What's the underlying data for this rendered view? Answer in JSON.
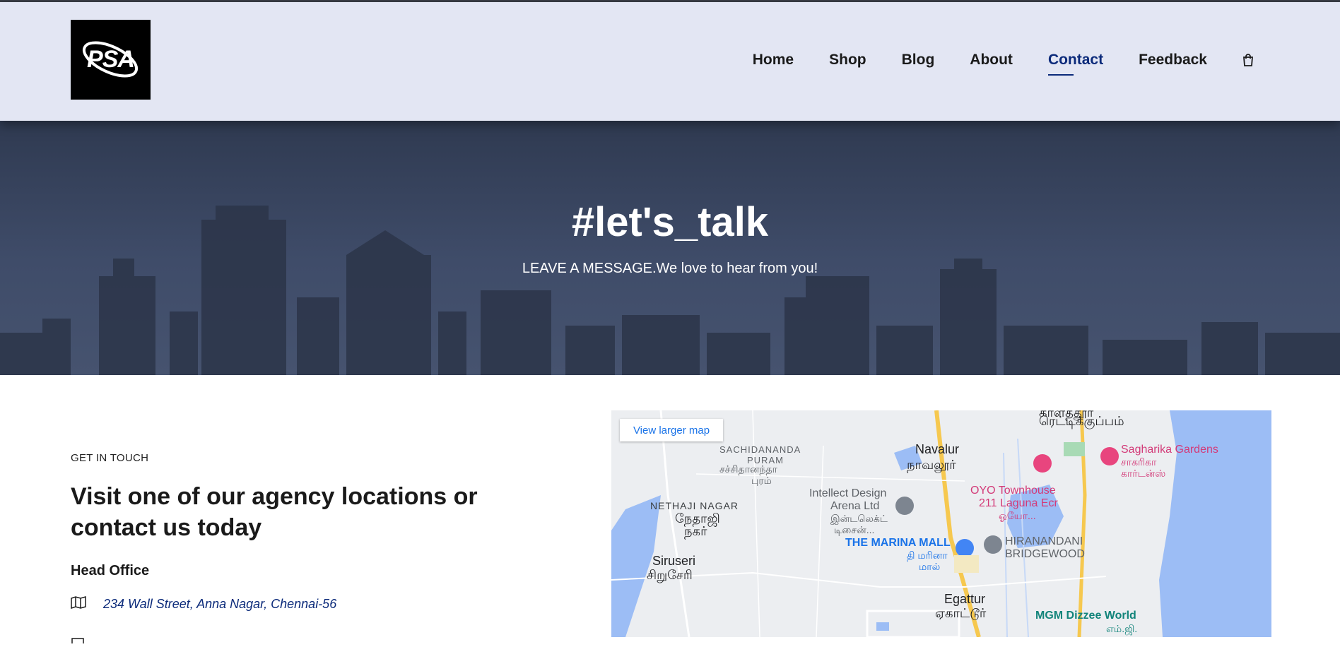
{
  "logo": {
    "text": "PSA"
  },
  "nav": {
    "items": [
      "Home",
      "Shop",
      "Blog",
      "About",
      "Contact",
      "Feedback"
    ],
    "active": "Contact"
  },
  "hero": {
    "title": "#let's_talk",
    "subtitle": "LEAVE A MESSAGE.We love to hear from you!"
  },
  "contact": {
    "eyebrow": "GET IN TOUCH",
    "heading": "Visit one of our agency locations or contact us today",
    "office_title": "Head Office",
    "address": "234 Wall Street, Anna Nagar, Chennai-56"
  },
  "map": {
    "button_label": "View larger map",
    "labels": {
      "top_right_1": "காளத்தூர்",
      "top_right_2": "ரெட்டிக்குப்பம்",
      "sachidananda_en": "SACHIDANANDA",
      "sachidananda_en2": "PURAM",
      "sachidananda_ta": "சச்சிதானந்தா",
      "sachidananda_ta2": "புரம்",
      "navalur_en": "Navalur",
      "navalur_ta": "நாவலூர்",
      "sagharika_en": "Sagharika Gardens",
      "sagharika_ta": "சாகரிகா",
      "sagharika_ta2": "கார்டன்ஸ்",
      "oyo_1": "OYO Townhouse",
      "oyo_2": "211 Laguna Ecr",
      "oyo_ta": "ஓயோ...",
      "intellect_1": "Intellect Design",
      "intellect_2": "Arena Ltd",
      "intellect_ta": "இன்டலெக்ட்",
      "intellect_ta2": "டிசைன்...",
      "nethaji_en": "NETHAJI NAGAR",
      "nethaji_ta": "நேதாஜி",
      "nethaji_ta2": "நகர்",
      "marina_en": "THE MARINA MALL",
      "marina_ta": "தி மரினா",
      "marina_ta2": "மால்",
      "hiranandani_1": "HIRANANDANI",
      "hiranandani_2": "BRIDGEWOOD",
      "siruseri_en": "Siruseri",
      "siruseri_ta": "சிறுசேரி",
      "egattur_en": "Egattur",
      "egattur_ta": "ஏகாட்டூர்",
      "mgm_en": "MGM Dizzee World",
      "mgm_ta": "எம்.ஜி."
    }
  },
  "colors": {
    "header_bg": "#e3e6f3",
    "accent": "#0b2a7a",
    "hero_bg": "#3f4c69",
    "map_water": "#9cbdf5",
    "map_road": "#f6c84f"
  }
}
